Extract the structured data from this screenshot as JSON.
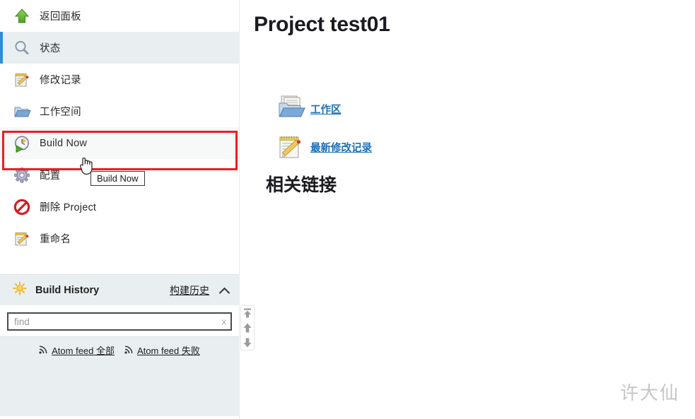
{
  "sidebar": {
    "nav_items": [
      {
        "label": "返回面板",
        "icon": "green-up-arrow-icon",
        "name": "back-to-dashboard",
        "state": "normal"
      },
      {
        "label": "状态",
        "icon": "magnifier-icon",
        "name": "status",
        "state": "active"
      },
      {
        "label": "修改记录",
        "icon": "notepad-pencil-icon",
        "name": "changes",
        "state": "normal"
      },
      {
        "label": "工作空间",
        "icon": "folder-icon",
        "name": "workspace",
        "state": "normal"
      },
      {
        "label": "Build Now",
        "icon": "clock-play-icon",
        "name": "build-now",
        "state": "hovered"
      },
      {
        "label": "配置",
        "icon": "gear-icon",
        "name": "configure",
        "state": "normal"
      },
      {
        "label": "删除 Project",
        "icon": "delete-prohibition-icon",
        "name": "delete-project",
        "state": "normal"
      },
      {
        "label": "重命名",
        "icon": "notepad-pencil-icon",
        "name": "rename",
        "state": "normal"
      }
    ],
    "build_history": {
      "title": "Build History",
      "icon": "sun-icon",
      "link_label": "构建历史",
      "collapse_icon": "chevron-up-icon",
      "find_placeholder": "find",
      "find_value": "",
      "clear_label": "x",
      "feeds": [
        {
          "label": "Atom feed 全部",
          "icon": "rss-icon",
          "name": "atom-feed-all"
        },
        {
          "label": "Atom feed 失败",
          "icon": "rss-icon",
          "name": "atom-feed-failed"
        }
      ]
    },
    "scroll_buttons": [
      {
        "name": "scroll-to-top-button",
        "icon": "arrow-to-top-icon"
      },
      {
        "name": "scroll-up-button",
        "icon": "arrow-up-icon"
      },
      {
        "name": "scroll-down-button",
        "icon": "arrow-down-icon"
      }
    ]
  },
  "main": {
    "page_title": "Project test01",
    "links": [
      {
        "label": "工作区",
        "icon": "folder-documents-icon",
        "name": "workspace-link"
      },
      {
        "label": "最新修改记录",
        "icon": "notepad-pencil-icon",
        "name": "recent-changes-link"
      }
    ],
    "related_heading": "相关链接"
  },
  "tooltip": {
    "text": "Build Now"
  },
  "watermark": {
    "text": "许大仙"
  },
  "colors": {
    "accent_blue": "#2d8fd2",
    "highlight_red": "#ee1c25",
    "link_blue": "#1c6fb5",
    "panel_bg": "#e9eff1"
  }
}
